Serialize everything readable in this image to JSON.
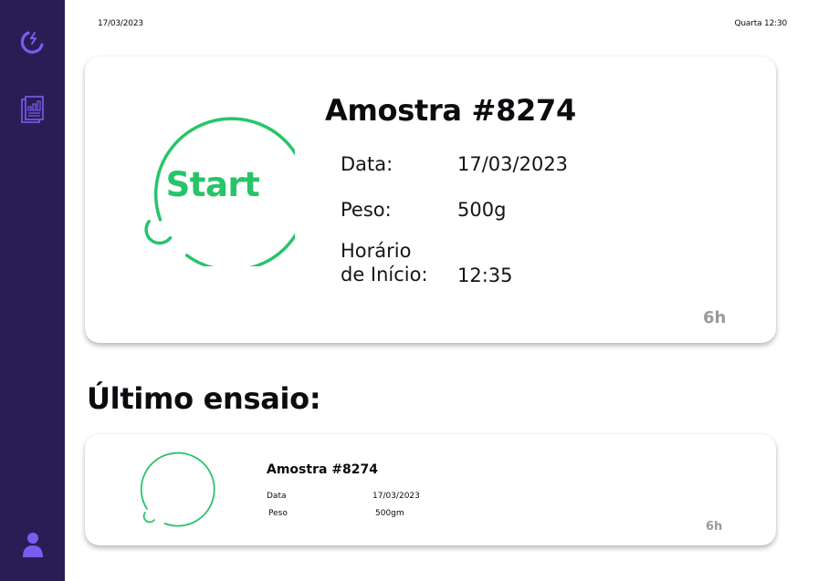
{
  "header": {
    "date": "17/03/2023",
    "clock": "Quarta 12:30"
  },
  "sidebar": {
    "items": [
      {
        "name": "magnet-bolt-icon"
      },
      {
        "name": "report-chart-icon"
      },
      {
        "name": "user-icon"
      }
    ]
  },
  "colors": {
    "sidebar_bg": "#2a1d55",
    "sidebar_icon": "#7b5cf0",
    "accent_green": "#27c46a",
    "muted": "#9a9a9a"
  },
  "current_sample": {
    "start_label": "Start",
    "title": "Amostra #8274",
    "date_label": "Data:",
    "date_value": "17/03/2023",
    "weight_label": "Peso:",
    "weight_value": "500g",
    "start_time_label": "Horário de Início:",
    "start_time_value": "12:35",
    "duration": "6h"
  },
  "last_test": {
    "heading": "Último ensaio:",
    "title": "Amostra #8274",
    "date_label": "Data",
    "date_value": "17/03/2023",
    "weight_label": "Peso",
    "weight_value": "500gm",
    "duration": "6h"
  }
}
